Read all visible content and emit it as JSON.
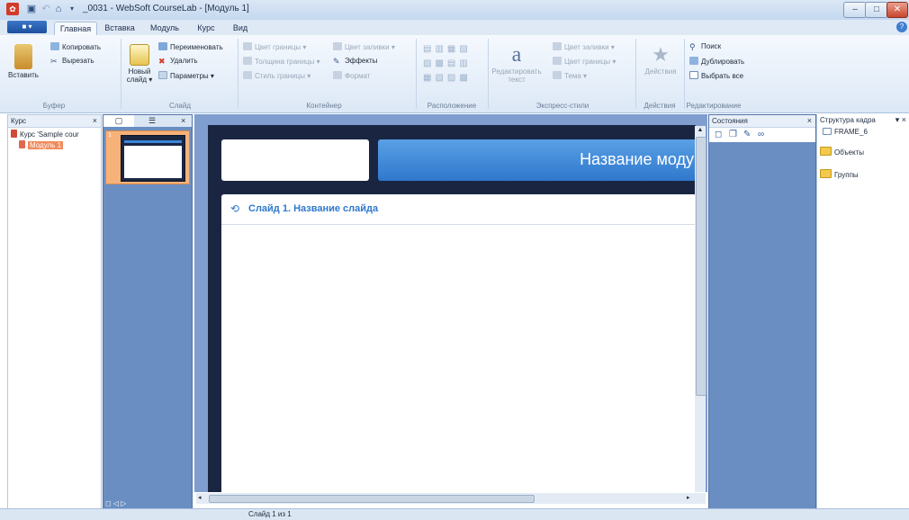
{
  "window": {
    "title": "_0031 - WebSoft CourseLab - [Модуль 1]",
    "controls": [
      "–",
      "□",
      "✕"
    ]
  },
  "ribbon_tabs": [
    "Главная",
    "Вставка",
    "Модуль",
    "Курс",
    "Вид"
  ],
  "file_button": "■ ▾",
  "groups": {
    "clipboard": {
      "label": "Буфер",
      "paste": "Вставить",
      "copy": "Копировать",
      "cut": "Вырезать"
    },
    "slide": {
      "label": "Слайд",
      "new_slide": "Новый\nслайд ▾",
      "rename": "Переименовать",
      "delete": "Удалить",
      "params": "Параметры ▾"
    },
    "container": {
      "label": "Контейнер",
      "border_color": "Цвет границы ▾",
      "fill_color": "Цвет заливки ▾",
      "border_width": "Толщина границы ▾",
      "effects": "Эффекты",
      "border_style": "Стиль границы ▾",
      "format": "Формат"
    },
    "arrange": {
      "label": "Расположение"
    },
    "express": {
      "label": "Экспресс-стили",
      "edit_text": "Редактировать\nтекст",
      "fill_color": "Цвет заливки ▾",
      "border_color": "Цвет границы ▾",
      "theme": "Тема ▾"
    },
    "actions": {
      "label": "Действия",
      "actions": "Действия"
    },
    "edit": {
      "label": "Редактирование",
      "search": "Поиск",
      "duplicate": "Дублировать",
      "select_all": "Выбрать все"
    }
  },
  "course_panel": {
    "title": "Курс",
    "tree": [
      "Курс 'Sample cour",
      "Модуль 1"
    ]
  },
  "slides_panel": {
    "slide_number": "1",
    "bottom_icons": "◻ ◁ ▷"
  },
  "stage": {
    "module_title": "Название моду",
    "slide_title": "Слайд 1. Название слайда"
  },
  "states_panel": {
    "title": "Состояния"
  },
  "structure_panel": {
    "title": "Структура кадра",
    "items": [
      "FRAME_6",
      "Объекты",
      "Группы"
    ]
  },
  "status": {
    "text": "Слайд 1 из 1"
  },
  "colors": {
    "accent": "#3b86d8",
    "stage_bg": "#1a2641",
    "panel_blue": "#6a8ec2"
  }
}
